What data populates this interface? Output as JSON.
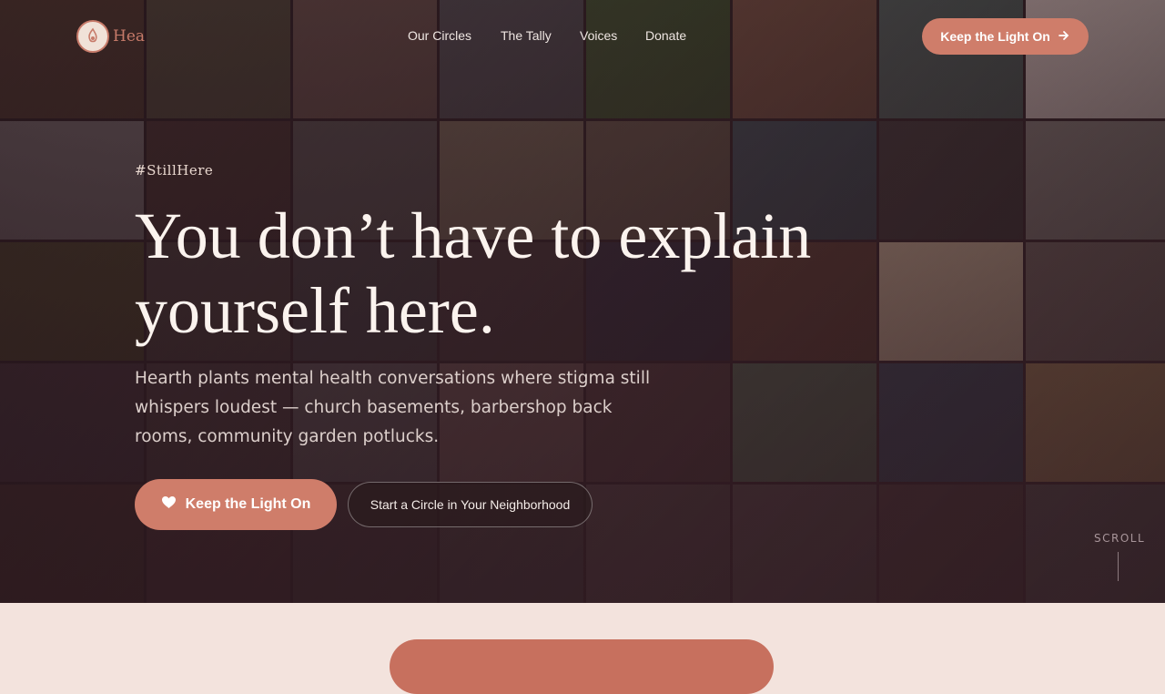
{
  "brand": {
    "name": "Hea",
    "accent": "#cf7d6a"
  },
  "nav": {
    "links": [
      "Our Circles",
      "The Tally",
      "Voices",
      "Donate"
    ],
    "cta_label": "Keep the Light On",
    "cta_icon": "arrow-right-icon"
  },
  "hero": {
    "hashtag": "#StillHere",
    "headline": "You don’t have to explain yourself here.",
    "subtext": "Hearth plants mental health conversations where stigma still whispers loudest — church basements, barbershop back rooms, community garden potlucks.",
    "primary_label": "Keep the Light On",
    "primary_icon": "heart-icon",
    "secondary_label": "Start a Circle in Your Neighborhood",
    "scroll_label": "SCROLL"
  },
  "photo_tiles": [
    "#7a5a3c",
    "#6f6a4a",
    "#8a6a5e",
    "#5b5b60",
    "#3e5a2e",
    "#7a5240",
    "#4b5a56",
    "#b8a8a4",
    "#c9c4c0",
    "#5a4038",
    "#6a6662",
    "#8a7a62",
    "#6a5a4a",
    "#3a4a52",
    "#3a3232",
    "#6e6662",
    "#6a6a2e",
    "#5a5048",
    "#4a4a4c",
    "#4a3a3a",
    "#2e2a3a",
    "#5a3a2e",
    "#b8a288",
    "#5a4e4a",
    "#5a4850",
    "#5a4a48",
    "#6e6a6a",
    "#7a5e5a",
    "#4e3838",
    "#4a5e4a",
    "#2e3a4a",
    "#7a6040",
    "#5a3e30",
    "#5a3a3a",
    "#4a3a3a",
    "#4a4040",
    "#4e4040",
    "#4a3e3e",
    "#3e2e2e",
    "#3e3838"
  ]
}
